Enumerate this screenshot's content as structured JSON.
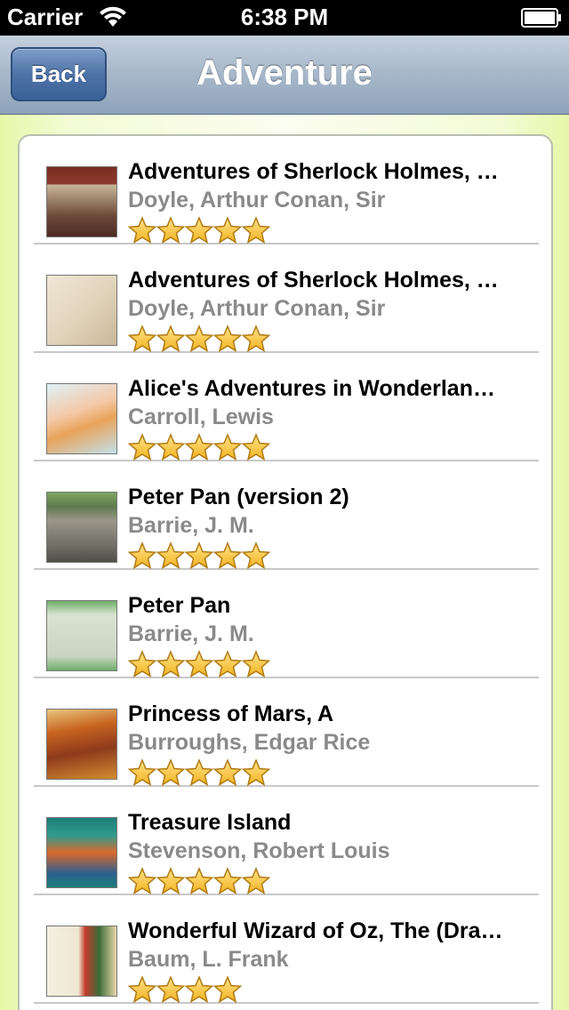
{
  "status_bar": {
    "carrier": "Carrier",
    "time": "6:38 PM"
  },
  "nav": {
    "back_label": "Back",
    "title": "Adventure"
  },
  "colors": {
    "star_fill": "#f7c531",
    "author_gray": "#8a8a8a",
    "nav_blue": "#8ea3bb"
  },
  "books": [
    {
      "title": "Adventures of Sherlock Holmes, …",
      "author": "Doyle, Arthur Conan, Sir",
      "rating": 5,
      "cover": "sherlock-1"
    },
    {
      "title": "Adventures of Sherlock Holmes, …",
      "author": "Doyle, Arthur Conan, Sir",
      "rating": 5,
      "cover": "sherlock-2"
    },
    {
      "title": "Alice's Adventures in Wonderlan…",
      "author": "Carroll, Lewis",
      "rating": 5,
      "cover": "alice"
    },
    {
      "title": "Peter Pan (version 2)",
      "author": "Barrie, J. M.",
      "rating": 5,
      "cover": "peter-pan-2"
    },
    {
      "title": "Peter Pan",
      "author": "Barrie, J. M.",
      "rating": 5,
      "cover": "peter-pan"
    },
    {
      "title": "Princess of Mars, A",
      "author": "Burroughs, Edgar Rice",
      "rating": 5,
      "cover": "princess-mars"
    },
    {
      "title": "Treasure Island",
      "author": "Stevenson, Robert Louis",
      "rating": 5,
      "cover": "treasure-island"
    },
    {
      "title": "Wonderful Wizard of Oz, The (Dra…",
      "author": "Baum, L. Frank",
      "rating": 4,
      "cover": "wizard-oz"
    }
  ]
}
